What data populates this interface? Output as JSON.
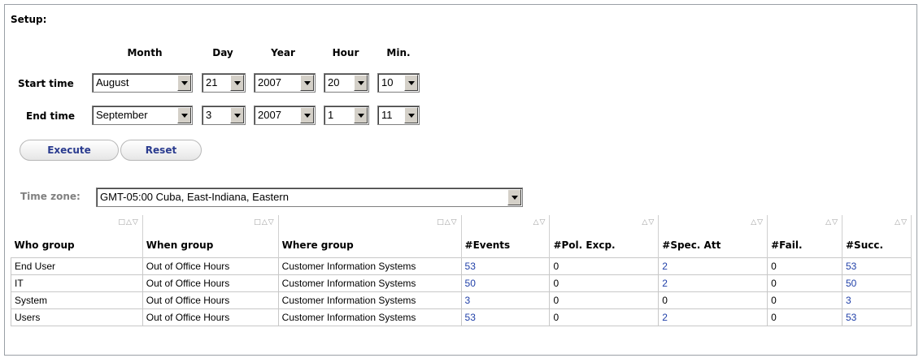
{
  "setup": {
    "title": "Setup:",
    "headers": {
      "month": "Month",
      "day": "Day",
      "year": "Year",
      "hour": "Hour",
      "min": "Min."
    },
    "start": {
      "label": "Start time",
      "month": "August",
      "day": "21",
      "year": "2007",
      "hour": "20",
      "min": "10"
    },
    "end": {
      "label": "End time",
      "month": "September",
      "day": "3",
      "year": "2007",
      "hour": "1",
      "min": "11"
    },
    "execute_label": "Execute",
    "reset_label": "Reset"
  },
  "timezone": {
    "label": "Time zone:",
    "value": "GMT-05:00 Cuba, East-Indiana, Eastern"
  },
  "table": {
    "columns": [
      "Who group",
      "When group",
      "Where group",
      "#Events",
      "#Pol. Excp.",
      "#Spec. Att",
      "#Fail.",
      "#Succ."
    ],
    "rows": [
      [
        "End User",
        "Out of Office Hours",
        "Customer Information Systems",
        "53",
        "0",
        "2",
        "0",
        "53"
      ],
      [
        "IT",
        "Out of Office Hours",
        "Customer Information Systems",
        "50",
        "0",
        "2",
        "0",
        "50"
      ],
      [
        "System",
        "Out of Office Hours",
        "Customer Information Systems",
        "3",
        "0",
        "0",
        "0",
        "3"
      ],
      [
        "Users",
        "Out of Office Hours",
        "Customer Information Systems",
        "53",
        "0",
        "2",
        "0",
        "53"
      ]
    ]
  },
  "colors": {
    "link": "#1f3fa8",
    "button_text": "#2a3b8f",
    "muted_label": "#808080"
  }
}
